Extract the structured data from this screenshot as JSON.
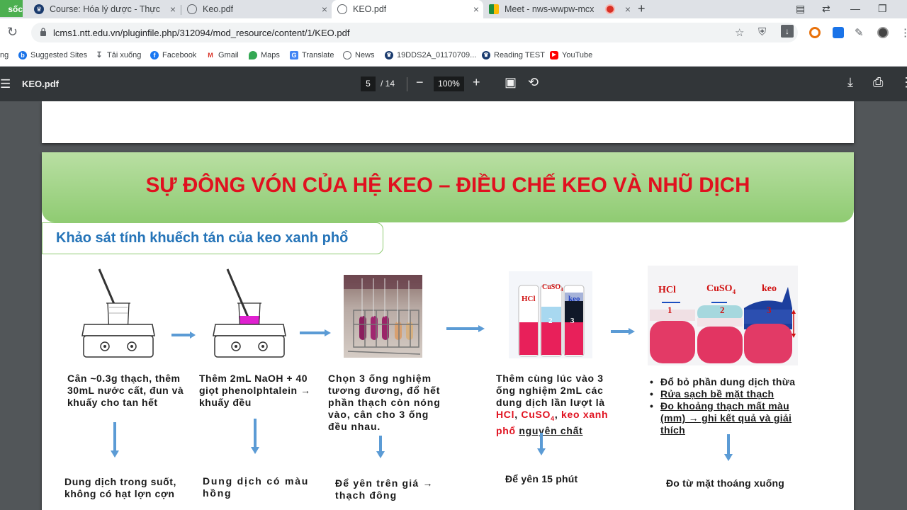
{
  "browser": {
    "tabs": [
      {
        "label": "Course: Hóa lý dược - Thực h",
        "icon": "course-icon"
      },
      {
        "label": "Keo.pdf",
        "icon": "globe-icon"
      },
      {
        "label": "KEO.pdf",
        "icon": "globe-icon",
        "active": true
      },
      {
        "label": "Meet - nws-wwpw-mcx",
        "icon": "meet-icon",
        "recording": true
      }
    ],
    "leftmost_tab_fragment": "sốc",
    "url": "lcms1.ntt.edu.vn/pluginfile.php/312094/mod_resource/content/1/KEO.pdf"
  },
  "bookmarks": [
    {
      "label": "ng",
      "icon": ""
    },
    {
      "label": "Suggested Sites",
      "icon": "bing-icon"
    },
    {
      "label": "Tải xuống",
      "icon": "download-icon"
    },
    {
      "label": "Facebook",
      "icon": "facebook-icon"
    },
    {
      "label": "Gmail",
      "icon": "gmail-icon"
    },
    {
      "label": "Maps",
      "icon": "maps-icon"
    },
    {
      "label": "Translate",
      "icon": "translate-icon"
    },
    {
      "label": "News",
      "icon": "globe-icon"
    },
    {
      "label": "19DDS2A_01170709...",
      "icon": "course-icon"
    },
    {
      "label": "Reading TEST",
      "icon": "course-icon"
    },
    {
      "label": "YouTube",
      "icon": "youtube-icon"
    }
  ],
  "pdf_viewer": {
    "title": "KEO.pdf",
    "current_page": "5",
    "total_pages": "/ 14",
    "zoom": "100%"
  },
  "slide": {
    "title": "SỰ ĐÔNG VÓN CỦA HỆ KEO – ĐIỀU CHẾ KEO VÀ NHŨ DỊCH",
    "subtitle": "Khảo sát tính khuếch tán của keo xanh phổ",
    "steps": [
      {
        "description": [
          "Cân ~0.3g thạch, thêm",
          "30mL nước cất, đun và",
          "khuấy cho tan hết"
        ],
        "result": [
          "Dung dịch trong suốt,",
          "không có hạt lợn cợn"
        ]
      },
      {
        "description": [
          "Thêm 2mL NaOH + 40",
          "giọt phenolphtalein →",
          "khuấy đều"
        ],
        "result": [
          "Dung dịch có màu",
          "hồng"
        ]
      },
      {
        "description": [
          "Chọn 3 ống nghiệm",
          "tương đương, đổ hết",
          "phần thạch còn nóng",
          "vào, cân cho 3 ống",
          "đều nhau."
        ],
        "result": [
          "Để yên trên giá →",
          "thạch đông"
        ]
      },
      {
        "description_lines": [
          "Thêm cùng lúc vào 3",
          "ống nghiệm 2mL các",
          "dung dịch lần lượt là"
        ],
        "reagents": {
          "hcl": "HCl",
          "sep1": ", ",
          "cuso4": "CuSO",
          "cuso4_sub": "4",
          "sep2": ", ",
          "keo1": "keo xanh",
          "keo2": "phổ",
          "tail": "nguyên chất"
        },
        "result": [
          "Để yên 15 phút"
        ]
      },
      {
        "bullets": [
          "Đổ bỏ phần dung dịch thừa",
          "Rửa sạch bề mặt thạch",
          "Đo khoảng thạch mất màu",
          "(mm) → ghi kết quả và giải",
          "thích"
        ],
        "result": [
          "Đo từ mặt thoáng xuống"
        ]
      }
    ],
    "photo_labels": {
      "small": [
        "HCl",
        "CuSO",
        "4",
        "keo",
        "1",
        "2",
        "3"
      ],
      "large": [
        "HCl",
        "CuSO",
        "4",
        "keo",
        "1",
        "2",
        "3"
      ]
    }
  },
  "colors": {
    "title_red": "#e0111f",
    "subtitle_blue": "#2574b8",
    "banner_green": "#8fcb72",
    "arrow_blue": "#5b9bd5"
  }
}
